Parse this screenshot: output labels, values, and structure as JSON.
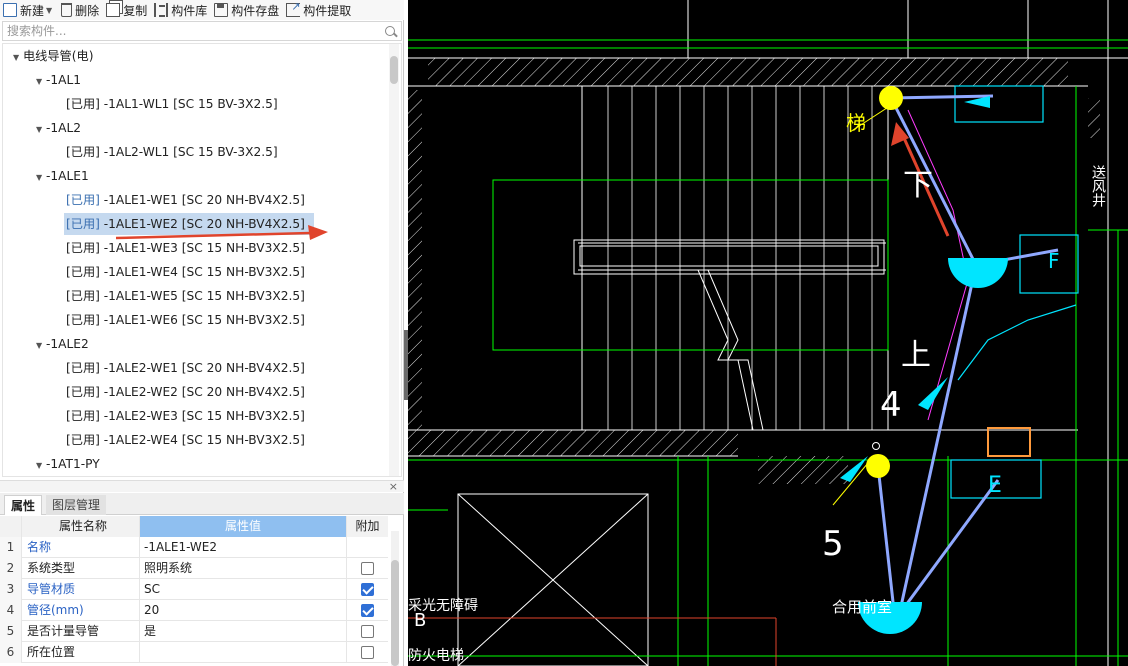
{
  "toolbar": {
    "new": "新建",
    "delete": "删除",
    "copy": "复制",
    "library": "构件库",
    "save": "构件存盘",
    "extract": "构件提取"
  },
  "search": {
    "placeholder": "搜索构件..."
  },
  "tree": {
    "root": "电线导管(电)",
    "groups": [
      {
        "label": "-1AL1",
        "items": [
          "[已用] -1AL1-WL1 [SC 15 BV-3X2.5]"
        ]
      },
      {
        "label": "-1AL2",
        "items": [
          "[已用] -1AL2-WL1 [SC 15 BV-3X2.5]"
        ]
      },
      {
        "label": "-1ALE1",
        "items": [
          {
            "prefix": "[已用]",
            "text": " -1ALE1-WE1 [SC 20 NH-BV4X2.5]"
          },
          {
            "prefix": "[已用]",
            "text": " -1ALE1-WE2 [SC 20 NH-BV4X2.5]"
          },
          "[已用] -1ALE1-WE3 [SC 15 NH-BV3X2.5]",
          "[已用] -1ALE1-WE4 [SC 15 NH-BV3X2.5]",
          "[已用] -1ALE1-WE5 [SC 15 NH-BV3X2.5]",
          "[已用] -1ALE1-WE6 [SC 15 NH-BV3X2.5]"
        ]
      },
      {
        "label": "-1ALE2",
        "items": [
          "[已用] -1ALE2-WE1 [SC 20 NH-BV4X2.5]",
          "[已用] -1ALE2-WE2 [SC 20 NH-BV4X2.5]",
          "[已用] -1ALE2-WE3 [SC 15 NH-BV3X2.5]",
          "[已用] -1ALE2-WE4 [SC 15 NH-BV3X2.5]"
        ]
      },
      {
        "label": "-1AT1-PY",
        "items": []
      }
    ],
    "selected": "-1ALE1-WE2"
  },
  "panel": {
    "close": "×",
    "tabs": [
      "属性",
      "图层管理"
    ],
    "active_tab": "属性"
  },
  "props": {
    "headers": [
      "属性名称",
      "属性值",
      "附加"
    ],
    "rows": [
      {
        "n": "1",
        "name": "名称",
        "value": "-1ALE1-WE2",
        "check": null,
        "blue": true
      },
      {
        "n": "2",
        "name": "系统类型",
        "value": "照明系统",
        "check": false,
        "blue": false
      },
      {
        "n": "3",
        "name": "导管材质",
        "value": "SC",
        "check": true,
        "blue": true
      },
      {
        "n": "4",
        "name": "管径(mm)",
        "value": "20",
        "check": true,
        "blue": true
      },
      {
        "n": "5",
        "name": "是否计量导管",
        "value": "是",
        "check": false,
        "blue": false
      },
      {
        "n": "6",
        "name": "所在位置",
        "value": "",
        "check": false,
        "blue": false
      }
    ]
  },
  "cad": {
    "texts": [
      "下",
      "上",
      "4",
      "5",
      "F",
      "E",
      "合用前室",
      "梯",
      "B",
      "送风井",
      "采光无障碍",
      "防火电梯"
    ],
    "colors": {
      "background": "#000000",
      "wall": "#ffffff",
      "green": "#00ff00",
      "cyan": "#00e5ff",
      "yellow": "#ffff00",
      "pipe": "#8fa8ff",
      "magenta": "#ff3cff",
      "red": "#e0442c",
      "orange": "#ff9a3c"
    }
  }
}
